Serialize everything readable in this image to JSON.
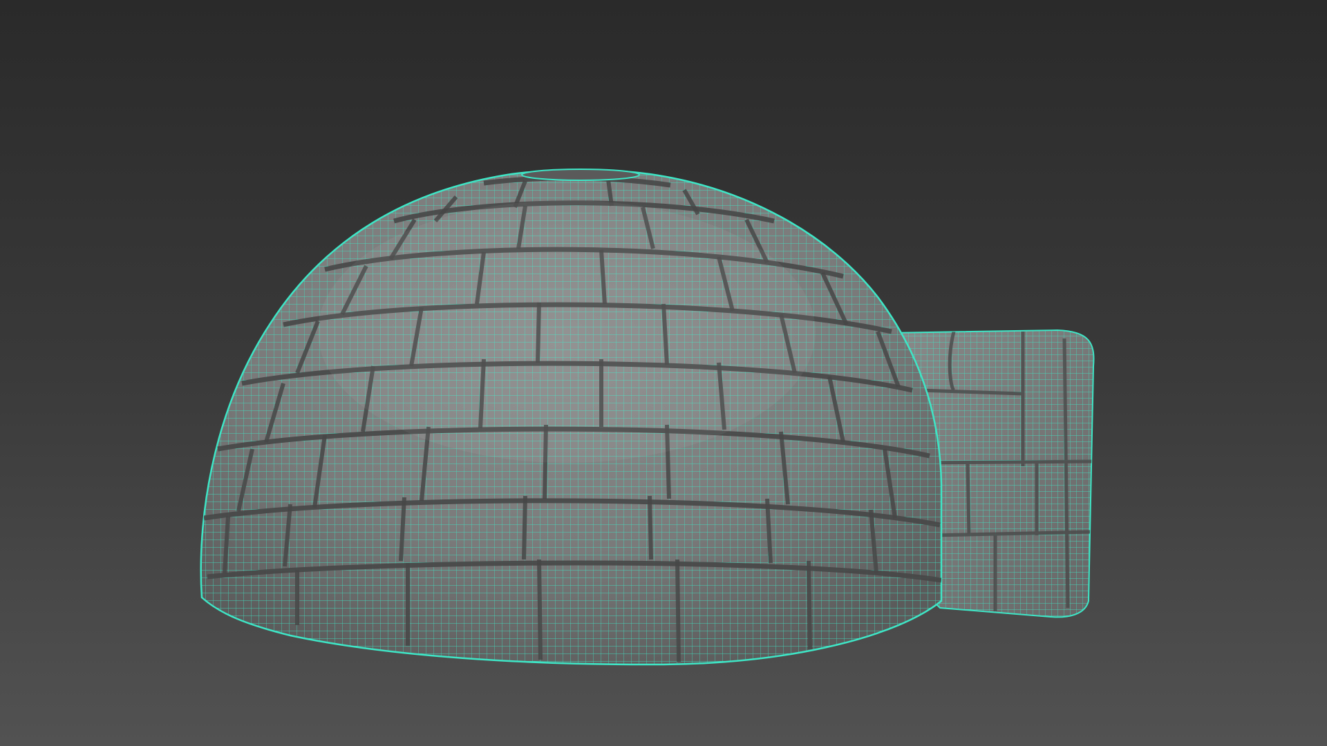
{
  "viewport": {
    "background_top": "#2a2a2a",
    "background_bottom": "#525252"
  },
  "model": {
    "object": "igloo",
    "shading": "shaded-with-wireframe",
    "surface_color": "#7f7f7f",
    "wire_color": "#3ee6c6",
    "joint_color": "#4a4a4a"
  }
}
